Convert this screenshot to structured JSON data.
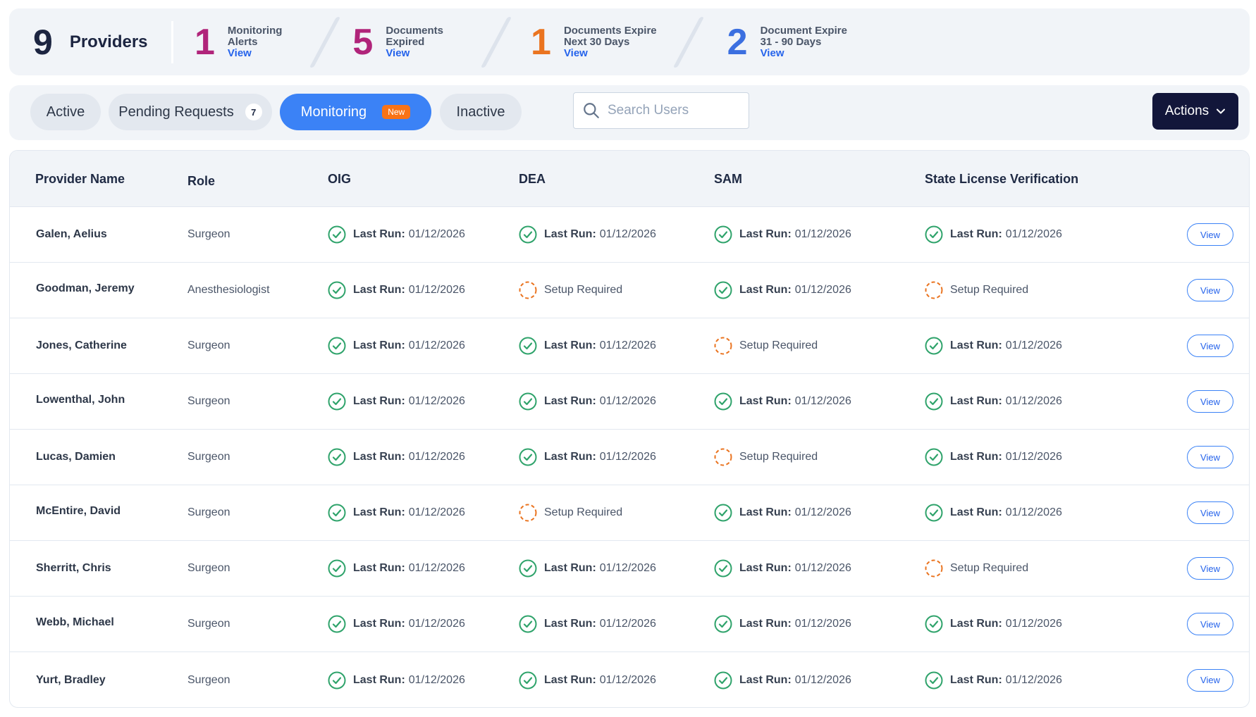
{
  "stats": {
    "providers": {
      "count": "9",
      "label": "Providers"
    },
    "items": [
      {
        "count": "1",
        "line1": "Monitoring",
        "line2": "Alerts",
        "link": "View",
        "color": "#b0247a"
      },
      {
        "count": "5",
        "line1": "Documents",
        "line2": "Expired",
        "link": "View",
        "color": "#b0247a"
      },
      {
        "count": "1",
        "line1": "Documents Expire",
        "line2": "Next 30 Days",
        "link": "View",
        "color": "#ea7420"
      },
      {
        "count": "2",
        "line1": "Document Expire",
        "line2": "31 - 90 Days",
        "link": "View",
        "color": "#3b6fe0"
      }
    ]
  },
  "tabs": {
    "active": "Active",
    "pending": "Pending Requests",
    "pending_count": "7",
    "monitoring": "Monitoring",
    "monitoring_badge": "New",
    "inactive": "Inactive"
  },
  "search": {
    "placeholder": "Search Users"
  },
  "actions_label": "Actions",
  "table": {
    "headers": {
      "name": "Provider Name",
      "role": "Role",
      "oig": "OIG",
      "dea": "DEA",
      "sam": "SAM",
      "slv": "State License Verification"
    },
    "status_labels": {
      "ok": "Last Run:",
      "setup": "Setup Required"
    },
    "view_label": "View",
    "rows": [
      {
        "name": "Galen, Aelius",
        "role": "Surgeon",
        "oig": "ok",
        "dea": "ok",
        "sam": "ok",
        "slv": "ok",
        "date": "01/12/2026"
      },
      {
        "name": "Goodman, Jeremy",
        "role": "Anesthesiologist",
        "oig": "ok",
        "dea": "setup",
        "sam": "ok",
        "slv": "setup",
        "date": "01/12/2026"
      },
      {
        "name": "Jones, Catherine",
        "role": "Surgeon",
        "oig": "ok",
        "dea": "ok",
        "sam": "setup",
        "slv": "ok",
        "date": "01/12/2026"
      },
      {
        "name": "Lowenthal, John",
        "role": "Surgeon",
        "oig": "ok",
        "dea": "ok",
        "sam": "ok",
        "slv": "ok",
        "date": "01/12/2026"
      },
      {
        "name": "Lucas, Damien",
        "role": "Surgeon",
        "oig": "ok",
        "dea": "ok",
        "sam": "setup",
        "slv": "ok",
        "date": "01/12/2026"
      },
      {
        "name": "McEntire, David",
        "role": "Surgeon",
        "oig": "ok",
        "dea": "setup",
        "sam": "ok",
        "slv": "ok",
        "date": "01/12/2026"
      },
      {
        "name": "Sherritt, Chris",
        "role": "Surgeon",
        "oig": "ok",
        "dea": "ok",
        "sam": "ok",
        "slv": "setup",
        "date": "01/12/2026"
      },
      {
        "name": "Webb, Michael",
        "role": "Surgeon",
        "oig": "ok",
        "dea": "ok",
        "sam": "ok",
        "slv": "ok",
        "date": "01/12/2026"
      },
      {
        "name": "Yurt, Bradley",
        "role": "Surgeon",
        "oig": "ok",
        "dea": "ok",
        "sam": "ok",
        "slv": "ok",
        "date": "01/12/2026"
      }
    ]
  },
  "colors": {
    "ok_icon": "#2fa36b",
    "setup_icon": "#ea7420",
    "primary": "#3b82f6",
    "actions_bg": "#12163a"
  }
}
